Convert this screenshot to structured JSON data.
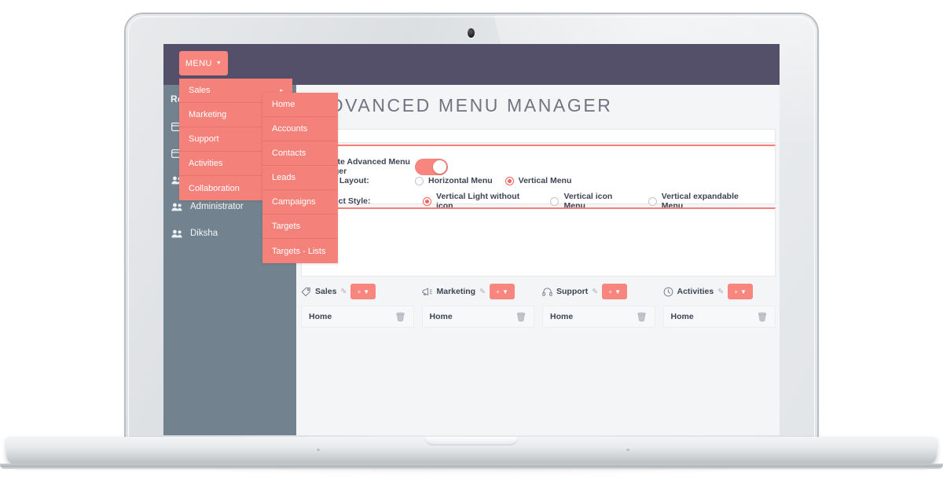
{
  "app": {
    "page_title": "ADVANCED MENU MANAGER",
    "colors": {
      "accent": "#f9867e",
      "menu_panel": "#f4817a",
      "topbar": "#54506a",
      "sidebar": "#72838f",
      "text_dark": "#3d4455",
      "title_gray": "#6f7480"
    }
  },
  "topbar": {
    "menu_button": {
      "label": "MENU",
      "caret": "▼",
      "icon": "chevron-down-icon"
    }
  },
  "menu": {
    "level1": [
      {
        "label": "Sales",
        "caret": "▸"
      },
      {
        "label": "Marketing",
        "caret": "▸"
      },
      {
        "label": "Support",
        "caret": "▸"
      },
      {
        "label": "Activities",
        "caret": "▸"
      },
      {
        "label": "Collaboration",
        "caret": "▸"
      }
    ],
    "level2": [
      {
        "label": "Home"
      },
      {
        "label": "Accounts"
      },
      {
        "label": "Contacts"
      },
      {
        "label": "Leads"
      },
      {
        "label": "Campaigns"
      },
      {
        "label": "Targets"
      },
      {
        "label": "Targets - Lists"
      }
    ]
  },
  "sidebar": {
    "items": [
      {
        "label": "Reports",
        "icon": "report-icon"
      },
      {
        "label": "",
        "icon": "card-icon"
      },
      {
        "label": "",
        "icon": "card-icon"
      },
      {
        "label": "",
        "icon": "users-icon"
      },
      {
        "label": "Administrator",
        "icon": "users-icon"
      },
      {
        "label": "Diksha",
        "icon": "users-icon"
      }
    ]
  },
  "settings": {
    "activate": {
      "label": "Activate Advanced Menu Manager",
      "toggle_on": true
    },
    "layout": {
      "label": "Select Layout:",
      "options": [
        {
          "label": "Horizontal Menu",
          "selected": false
        },
        {
          "label": "Vertical Menu",
          "selected": true
        }
      ]
    },
    "style": {
      "label": "Select Style:",
      "options": [
        {
          "label": "Vertical Light without icon",
          "selected": true
        },
        {
          "label": "Vertical icon Menu",
          "selected": false
        },
        {
          "label": "Vertical expandable Menu",
          "selected": false
        }
      ]
    }
  },
  "menu_columns": [
    {
      "title": "Sales",
      "icon": "tag-icon",
      "edit_icon": "pencil-icon",
      "add_label": "+",
      "add_caret": "▼",
      "items": [
        {
          "label": "Home",
          "delete_icon": "trash-icon"
        }
      ]
    },
    {
      "title": "Marketing",
      "icon": "megaphone-icon",
      "edit_icon": "pencil-icon",
      "add_label": "+",
      "add_caret": "▼",
      "items": [
        {
          "label": "Home",
          "delete_icon": "trash-icon"
        }
      ]
    },
    {
      "title": "Support",
      "icon": "headset-icon",
      "edit_icon": "pencil-icon",
      "add_label": "+",
      "add_caret": "▼",
      "items": [
        {
          "label": "Home",
          "delete_icon": "trash-icon"
        }
      ]
    },
    {
      "title": "Activities",
      "icon": "clock-icon",
      "edit_icon": "pencil-icon",
      "add_label": "+",
      "add_caret": "▼",
      "items": [
        {
          "label": "Home",
          "delete_icon": "trash-icon"
        }
      ]
    }
  ]
}
